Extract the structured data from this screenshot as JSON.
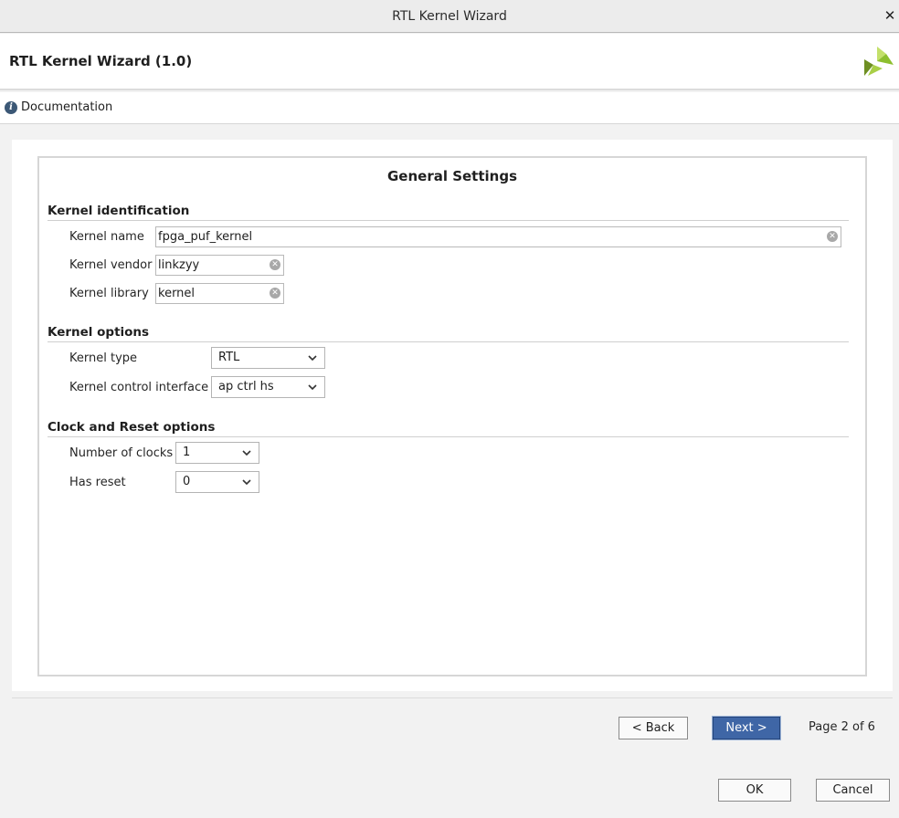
{
  "window": {
    "title": "RTL Kernel Wizard",
    "close_glyph": "✕"
  },
  "header": {
    "title": "RTL Kernel Wizard (1.0)",
    "logo_icon": "vivado-leaf-logo"
  },
  "docbar": {
    "label": "Documentation",
    "icon": "info-icon"
  },
  "panel": {
    "title": "General Settings",
    "identification": {
      "title": "Kernel identification",
      "name_label": "Kernel name",
      "name_value": "fpga_puf_kernel",
      "vendor_label": "Kernel vendor",
      "vendor_value": "linkzyy",
      "library_label": "Kernel library",
      "library_value": "kernel"
    },
    "options": {
      "title": "Kernel options",
      "type_label": "Kernel type",
      "type_value": "RTL",
      "control_label": "Kernel control interface",
      "control_value": "ap ctrl hs"
    },
    "clock": {
      "title": "Clock and Reset options",
      "clocks_label": "Number of clocks",
      "clocks_value": "1",
      "reset_label": "Has reset",
      "reset_value": "0"
    }
  },
  "nav": {
    "back_label": "< Back",
    "next_label": "Next >",
    "page_info": "Page 2 of 6"
  },
  "footer": {
    "ok_label": "OK",
    "cancel_label": "Cancel"
  },
  "colors": {
    "primary_button": "#3f66a6",
    "logo_green": "#8dbf2e",
    "info_icon": "#3c5876"
  }
}
